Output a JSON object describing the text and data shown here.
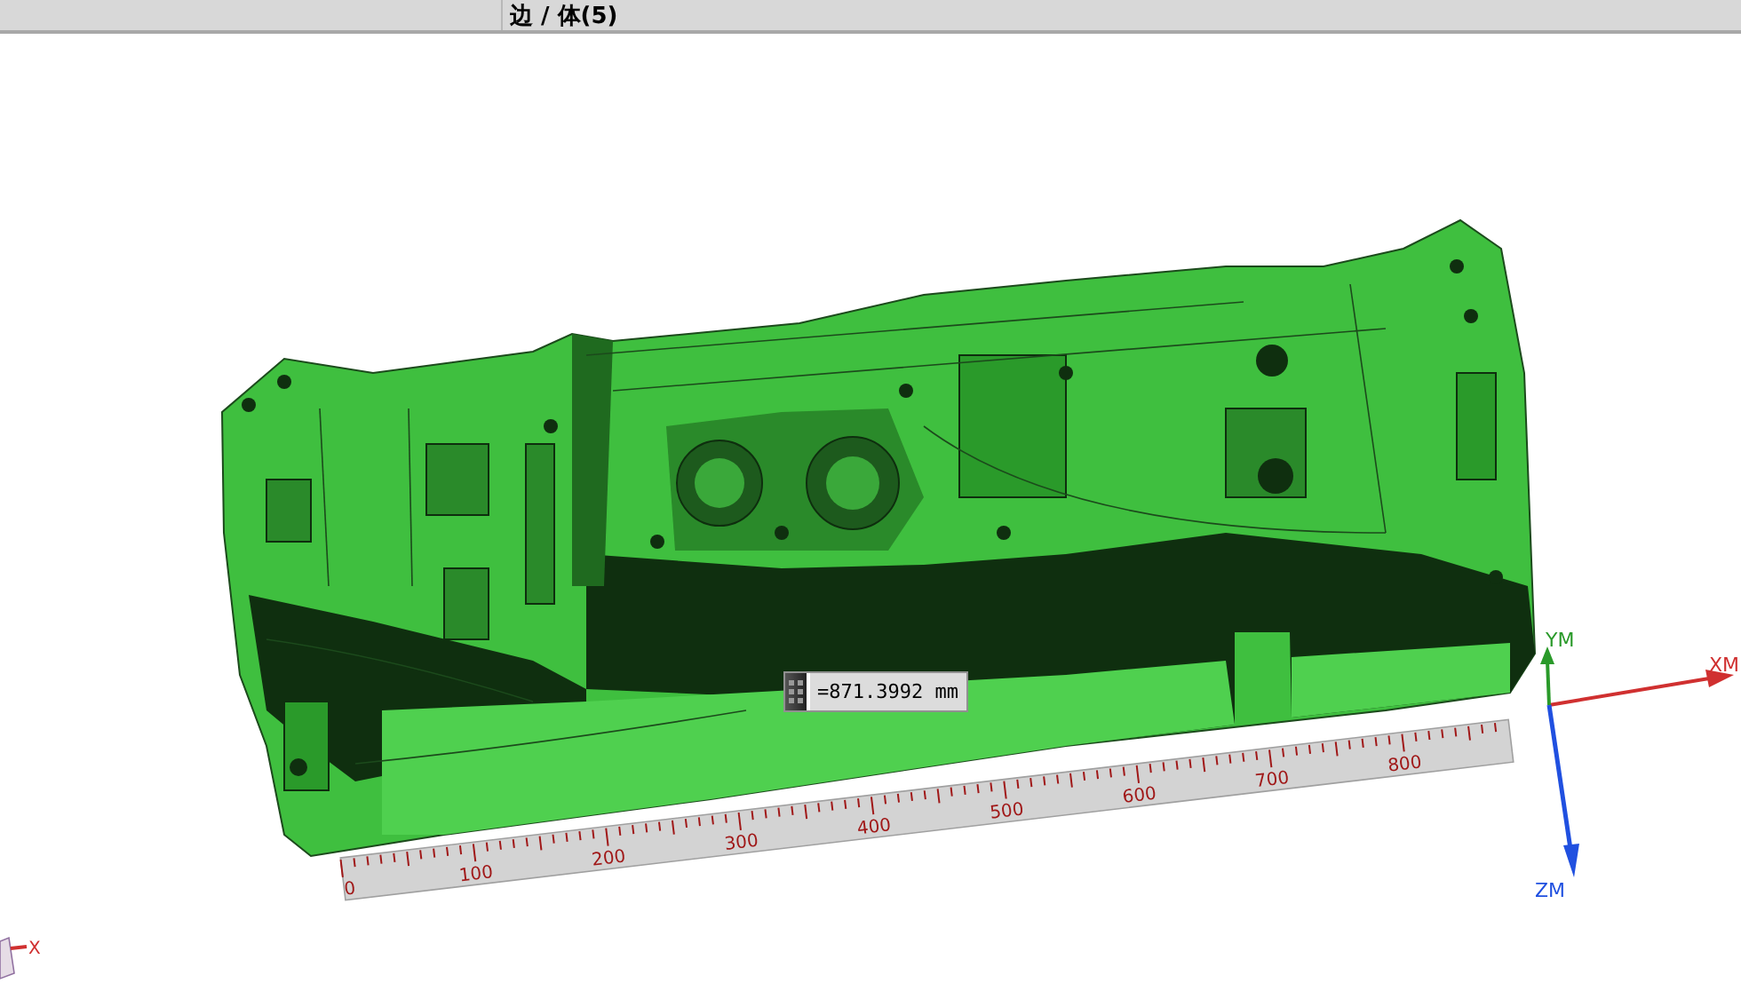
{
  "status_bar": {
    "selection_filter": "边 / 体(5)"
  },
  "viewport": {
    "measurement": {
      "value": "=871.3992 mm"
    },
    "ruler": {
      "labels": [
        "0",
        "100",
        "200",
        "300",
        "400",
        "500",
        "600",
        "700",
        "800"
      ]
    },
    "axes": {
      "x": "XM",
      "y": "YM",
      "z": "ZM"
    },
    "view_triad": {
      "x": "X"
    }
  }
}
